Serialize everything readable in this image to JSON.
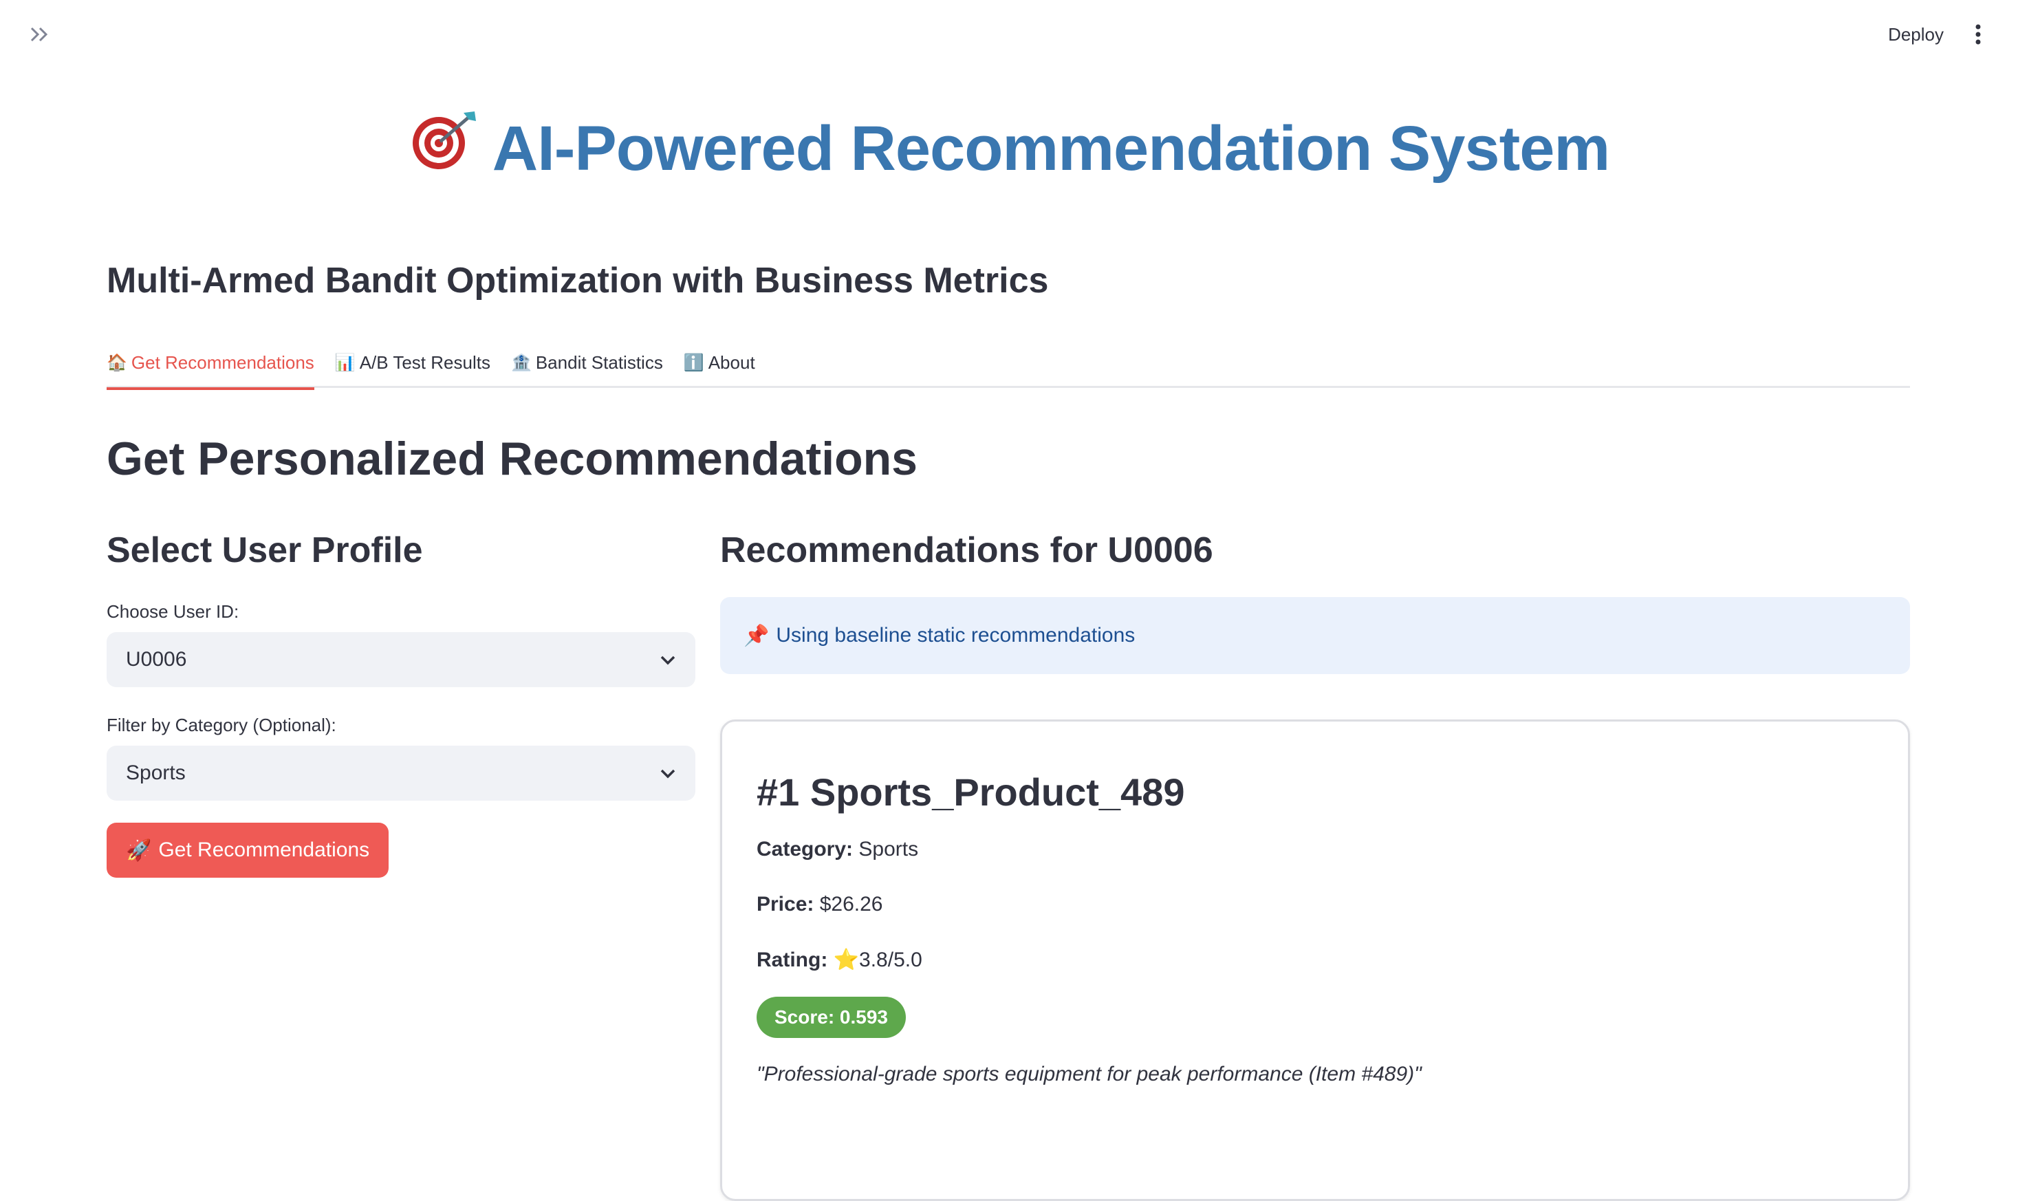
{
  "topbar": {
    "deploy_label": "Deploy"
  },
  "header": {
    "title": "AI-Powered Recommendation System",
    "subtitle": "Multi-Armed Bandit Optimization with Business Metrics"
  },
  "tabs": [
    {
      "label": "Get Recommendations",
      "icon": "house-emoji",
      "active": true
    },
    {
      "label": "A/B Test Results",
      "icon": "bar-chart-emoji",
      "active": false
    },
    {
      "label": "Bandit Statistics",
      "icon": "bank-emoji",
      "active": false
    },
    {
      "label": "About",
      "icon": "info-emoji",
      "active": false
    }
  ],
  "main": {
    "section_title": "Get Personalized Recommendations",
    "left": {
      "heading": "Select User Profile",
      "user_label": "Choose User ID:",
      "user_value": "U0006",
      "category_label": "Filter by Category (Optional):",
      "category_value": "Sports",
      "button_label": "Get Recommendations"
    },
    "right": {
      "heading": "Recommendations for U0006",
      "info_text": "Using baseline static recommendations",
      "card": {
        "title": "#1 Sports_Product_489",
        "category_label": "Category:",
        "category_value": "Sports",
        "price_label": "Price:",
        "price_value": "$26.26",
        "rating_label": "Rating:",
        "rating_value": "3.8/5.0",
        "score_text": "Score: 0.593",
        "description": "\"Professional-grade sports equipment for peak performance (Item #489)\""
      }
    }
  },
  "colors": {
    "title_blue": "#3a77b0",
    "accent_red": "#e6544d",
    "button_red": "#ef5a55",
    "score_green": "#5ea84c",
    "info_bg": "#eaf1fc",
    "info_text": "#1d4f91"
  }
}
